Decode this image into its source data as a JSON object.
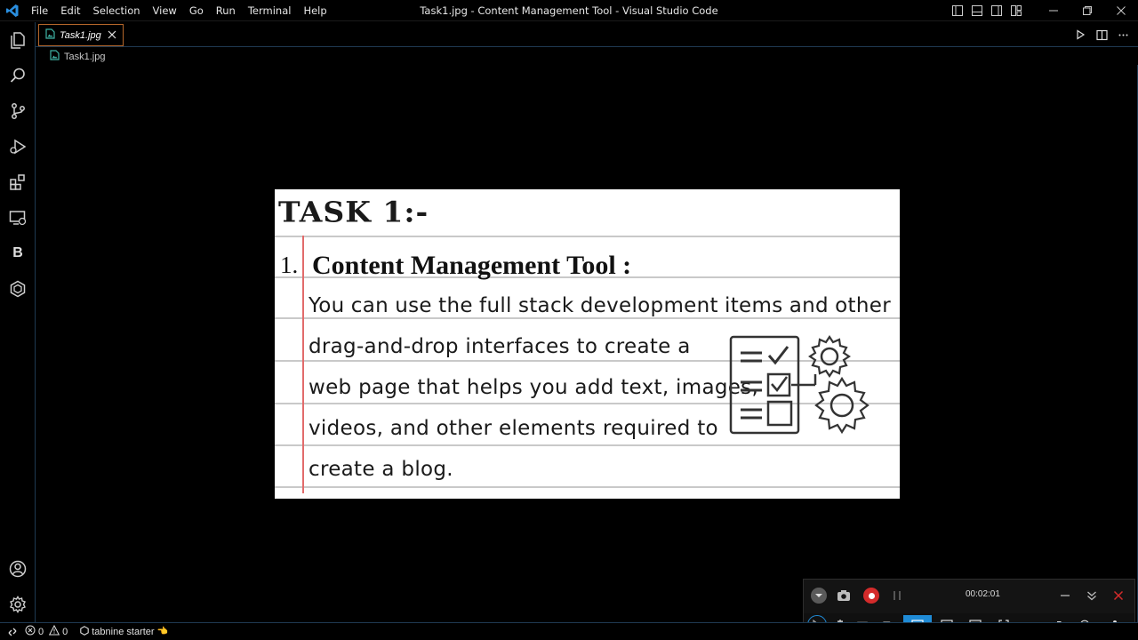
{
  "titlebar": {
    "menu": [
      "File",
      "Edit",
      "Selection",
      "View",
      "Go",
      "Run",
      "Terminal",
      "Help"
    ],
    "window_title": "Task1.jpg - Content Management Tool - Visual Studio Code",
    "accent_color": "#2a8fe0"
  },
  "activitybar": {
    "items": [
      "explorer-icon",
      "search-icon",
      "source-control-icon",
      "run-debug-icon",
      "extensions-icon",
      "remote-explorer-icon",
      "blackbox-icon",
      "tabnine-icon"
    ],
    "blackbox_label": "B",
    "bottom": [
      "account-icon",
      "manage-gear-icon"
    ]
  },
  "tab": {
    "label": "Task1.jpg",
    "border_color": "#b4662a"
  },
  "breadcrumb": {
    "label": "Task1.jpg"
  },
  "preview": {
    "task_title": "TASK 1:-",
    "number": "1.",
    "heading": "Content Management Tool :",
    "line1": [
      "You",
      "can",
      "use",
      "the",
      "full",
      "stack",
      "development",
      "items",
      "and",
      "other"
    ],
    "line2": "drag-and-drop interfaces to create a",
    "line3": "web page that helps you add text, images,",
    "line4": "videos, and other elements required to",
    "line5": "create a blog."
  },
  "recorder": {
    "time": "00:02:01",
    "record_color": "#d42b2b"
  },
  "statusbar": {
    "errors": "0",
    "warnings": "0",
    "tabnine": "tabnine starter",
    "tabnine_emoji": "👈"
  }
}
